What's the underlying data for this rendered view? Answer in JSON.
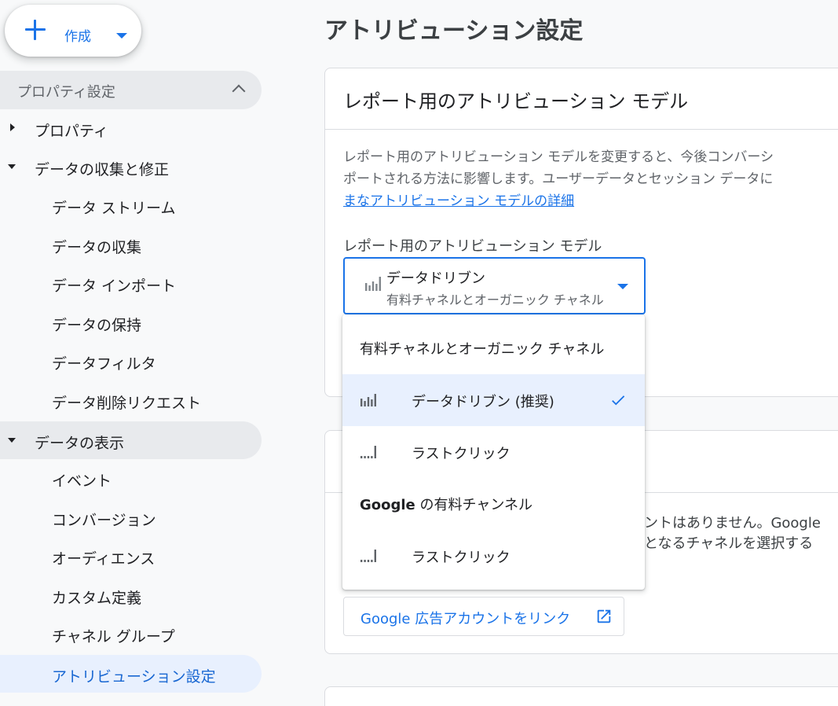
{
  "create_button": {
    "label": "作成",
    "icon": "plus-icon"
  },
  "sidebar": {
    "section_title": "プロパティ設定",
    "items": [
      {
        "label": "プロパティ",
        "level": "parent",
        "expanded": false
      },
      {
        "label": "データの収集と修正",
        "level": "parent",
        "expanded": true
      },
      {
        "label": "データ ストリーム",
        "level": "child"
      },
      {
        "label": "データの収集",
        "level": "child"
      },
      {
        "label": "データ インポート",
        "level": "child"
      },
      {
        "label": "データの保持",
        "level": "child"
      },
      {
        "label": "データフィルタ",
        "level": "child"
      },
      {
        "label": "データ削除リクエスト",
        "level": "child"
      },
      {
        "label": "データの表示",
        "level": "parent",
        "expanded": true
      },
      {
        "label": "イベント",
        "level": "child"
      },
      {
        "label": "コンバージョン",
        "level": "child"
      },
      {
        "label": "オーディエンス",
        "level": "child"
      },
      {
        "label": "カスタム定義",
        "level": "child"
      },
      {
        "label": "チャネル グループ",
        "level": "child"
      },
      {
        "label": "アトリビューション設定",
        "level": "child",
        "active": true
      }
    ]
  },
  "page": {
    "title": "アトリビューション設定"
  },
  "reporting_card": {
    "title": "レポート用のアトリビューション モデル",
    "description_line1": "レポート用のアトリビューション モデルを変更すると、今後コンバーシ",
    "description_line2": "ポートされる方法に影響します。ユーザーデータとセッション データに",
    "description_link": "まなアトリビューション モデルの詳細",
    "field_label": "レポート用のアトリビューション モデル",
    "selected_value": "データドリブン",
    "selected_group": "有料チャネルとオーガニック チャネル"
  },
  "dropdown": {
    "group1_label": "有料チャネルとオーガニック チャネル",
    "group1_options": [
      {
        "label": "データドリブン (推奨)",
        "icon": "data-driven-bars-icon",
        "selected": true
      },
      {
        "label": "ラストクリック",
        "icon": "last-click-bars-icon",
        "selected": false
      }
    ],
    "group2_brand": "Google",
    "group2_rest": " の有料チャンネル",
    "group2_options": [
      {
        "label": "ラストクリック",
        "icon": "last-click-bars-icon",
        "selected": false
      }
    ]
  },
  "ads_card": {
    "partial_line1": "ウントはありません。Google",
    "partial_line2": "象となるチャネルを選択する",
    "link_button_label": "Google 広告アカウントをリンク",
    "link_button_icon": "open-in-new-icon"
  },
  "colors": {
    "accent": "#1a73e8",
    "selected_bg": "#e8f0fe",
    "hover_bg": "#e8eaed",
    "sidebar_bg": "#f8f9fa"
  }
}
